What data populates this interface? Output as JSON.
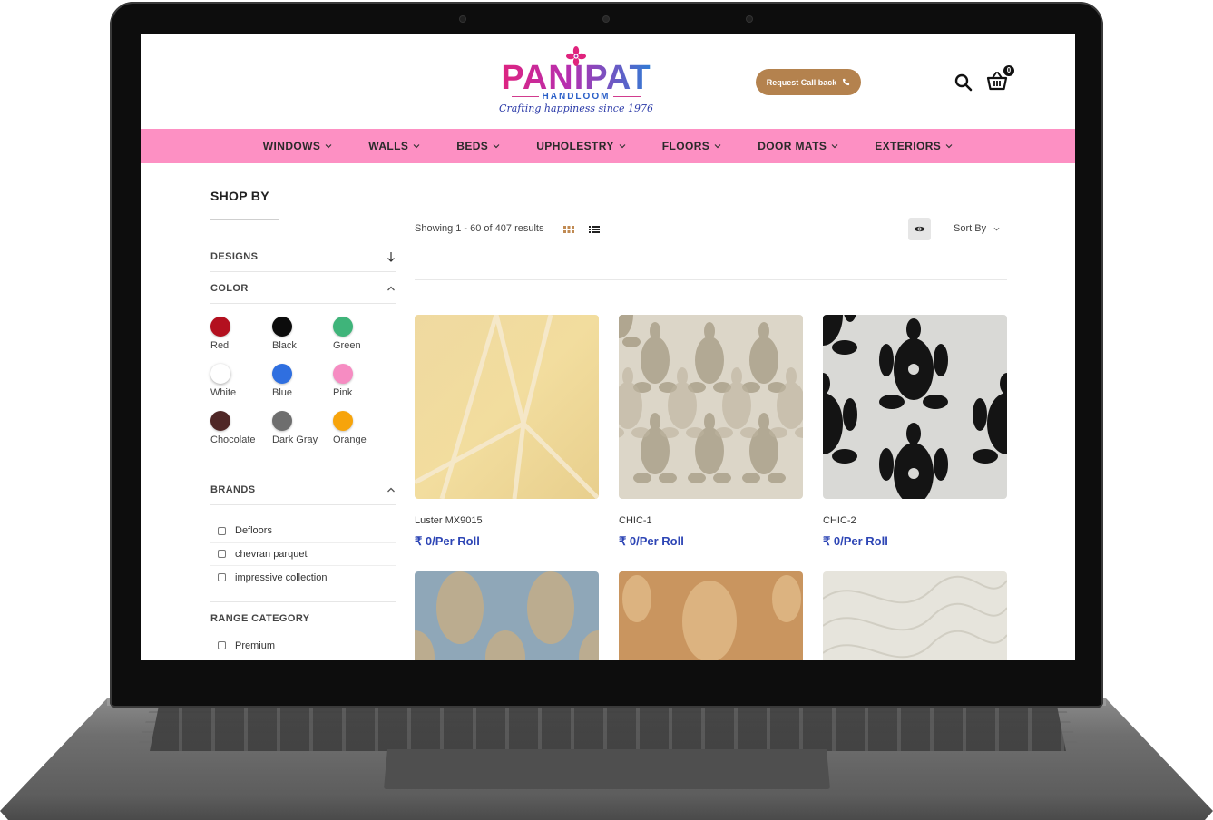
{
  "brand": {
    "name": "PANIPAT",
    "sub": "HANDLOOM",
    "tagline": "Crafting happiness since 1976"
  },
  "header": {
    "callback_label": "Request Call back",
    "cart_count": "0",
    "icons": [
      "search-icon",
      "cart-icon",
      "phone-icon"
    ]
  },
  "nav": {
    "items": [
      "WINDOWS",
      "WALLS",
      "BEDS",
      "UPHOLESTRY",
      "FLOORS",
      "DOOR MATS",
      "EXTERIORS"
    ]
  },
  "sidebar": {
    "title": "SHOP BY",
    "designs_label": "DESIGNS",
    "color_label": "COLOR",
    "colors": [
      {
        "label": "Red",
        "hex": "#b3101f"
      },
      {
        "label": "Black",
        "hex": "#0c0c0c"
      },
      {
        "label": "Green",
        "hex": "#3fb47a"
      },
      {
        "label": "White",
        "hex": "#ffffff"
      },
      {
        "label": "Blue",
        "hex": "#2f6fe0"
      },
      {
        "label": "Pink",
        "hex": "#f68cc2"
      },
      {
        "label": "Chocolate",
        "hex": "#4f2726"
      },
      {
        "label": "Dark Gray",
        "hex": "#6e6e6e"
      },
      {
        "label": "Orange",
        "hex": "#f7a40b"
      }
    ],
    "brands_label": "BRANDS",
    "brands": [
      "Defloors",
      "chevran parquet",
      "impressive collection"
    ],
    "range_label": "RANGE CATEGORY",
    "ranges": [
      "Premium"
    ]
  },
  "toolbar": {
    "showing": "Showing 1 - 60 of 407 results",
    "sort_label": "Sort By"
  },
  "products": [
    {
      "name": "Luster MX9015",
      "price": "₹ 0/Per Roll"
    },
    {
      "name": "CHIC-1",
      "price": "₹ 0/Per Roll"
    },
    {
      "name": "CHIC-2",
      "price": "₹ 0/Per Roll"
    }
  ]
}
